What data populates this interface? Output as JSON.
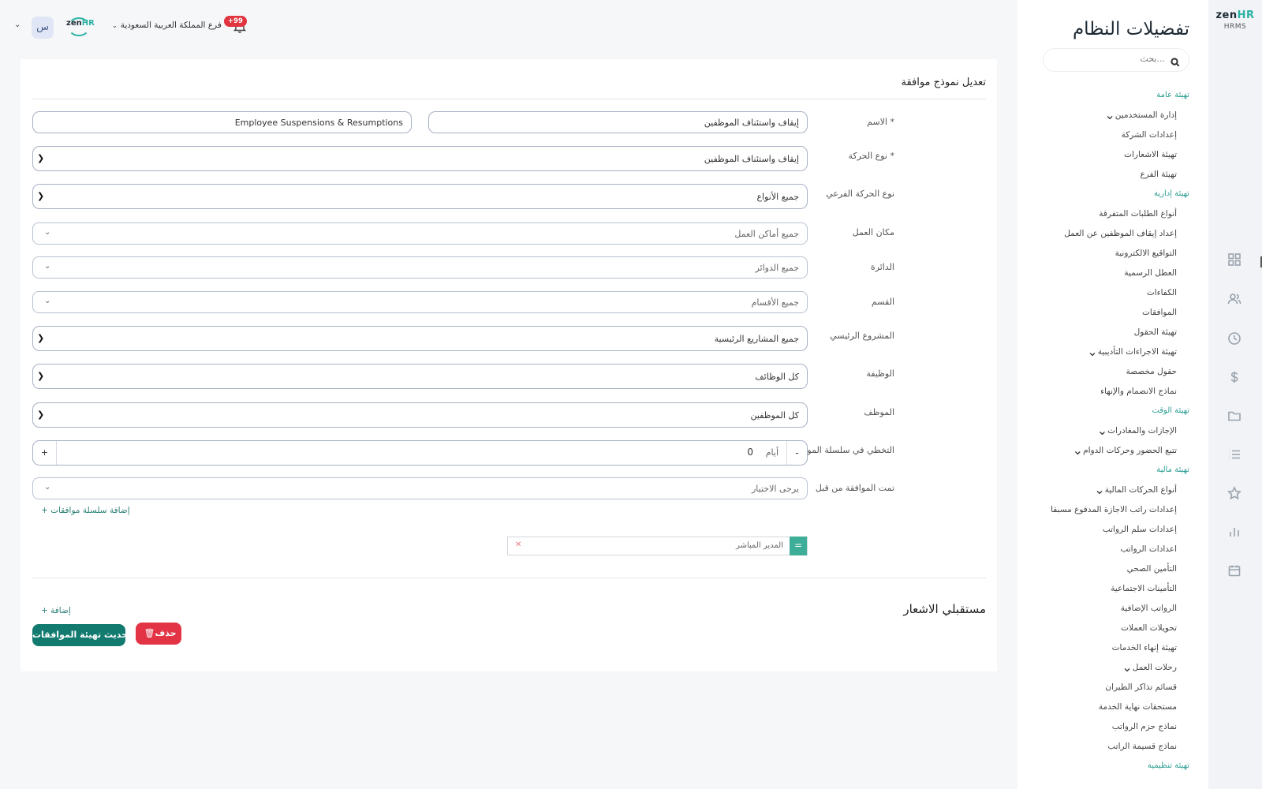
{
  "brand": {
    "logo_main": "zen",
    "logo_accent": "HR",
    "logo_sub": "HRMS"
  },
  "rail": {
    "icons": [
      "grid-icon",
      "users-icon",
      "clock-icon",
      "dollar-icon",
      "folder-icon",
      "list-icon",
      "star-icon",
      "bar-chart-icon",
      "calendar-icon"
    ]
  },
  "topbar": {
    "avatar_letter": "س",
    "branch_label": "فرع المملكة العربية السعودية",
    "notifications_badge": "+99"
  },
  "settings_panel": {
    "title": "تفضيلات النظام",
    "search_placeholder": "بحث...",
    "items": [
      {
        "type": "section",
        "label": "تهيئة عامة"
      },
      {
        "type": "item",
        "label": "إدارة المستخدمين",
        "has_chevron": true
      },
      {
        "type": "item",
        "label": "إعدادات الشركة"
      },
      {
        "type": "item",
        "label": "تهيئة الاشعارات"
      },
      {
        "type": "item",
        "label": "تهيئة الفرع"
      },
      {
        "type": "section",
        "label": "تهيئة إدارية"
      },
      {
        "type": "item",
        "label": "أنواع الطلبات المتفرقة"
      },
      {
        "type": "item",
        "label": "إعداد إيقاف الموظفين عن العمل"
      },
      {
        "type": "item",
        "label": "التواقيع الالكترونية"
      },
      {
        "type": "item",
        "label": "العطل الرسمية"
      },
      {
        "type": "item",
        "label": "الكفاءات"
      },
      {
        "type": "item",
        "label": "الموافقات"
      },
      {
        "type": "item",
        "label": "تهيئة الحقول"
      },
      {
        "type": "item",
        "label": "تهيئة الاجراءات التأديبية",
        "has_chevron": true
      },
      {
        "type": "item",
        "label": "حقول مخصصة"
      },
      {
        "type": "item",
        "label": "نماذج الانضمام والإنهاء"
      },
      {
        "type": "section",
        "label": "تهيئة الوقت"
      },
      {
        "type": "item",
        "label": "الإجازات والمغادرات",
        "has_chevron": true
      },
      {
        "type": "item",
        "label": "تتبع الحضور وحركات الدوام",
        "has_chevron": true
      },
      {
        "type": "section",
        "label": "تهيئة مالية"
      },
      {
        "type": "item",
        "label": "أنواع الحركات المالية",
        "has_chevron": true
      },
      {
        "type": "item",
        "label": "إعدادات راتب الاجازة المدفوع مسبقا"
      },
      {
        "type": "item",
        "label": "إعدادات سلم الرواتب"
      },
      {
        "type": "item",
        "label": "اعدادات الرواتب"
      },
      {
        "type": "item",
        "label": "التأمين الصحي"
      },
      {
        "type": "item",
        "label": "التأمينات الاجتماعية"
      },
      {
        "type": "item",
        "label": "الرواتب الإضافية"
      },
      {
        "type": "item",
        "label": "تحويلات العملات"
      },
      {
        "type": "item",
        "label": "تهيئة إنهاء الخدمات"
      },
      {
        "type": "item",
        "label": "رحلات العمل",
        "has_chevron": true
      },
      {
        "type": "item",
        "label": "قسائم تذاكر الطيران"
      },
      {
        "type": "item",
        "label": "مستحقات نهاية الخدمة"
      },
      {
        "type": "item",
        "label": "نماذج حزم الرواتب"
      },
      {
        "type": "item",
        "label": "نماذج قسيمة الراتب"
      },
      {
        "type": "section",
        "label": "تهيئة تنظيمية"
      }
    ]
  },
  "form": {
    "title": "تعديل نموذج موافقة",
    "name_label": "الاسم *",
    "name_ar": "إيقاف واستئناف الموظفين",
    "name_en": "Employee Suspensions & Resumptions",
    "movement_type_label": "نوع الحركة *",
    "movement_type_value": "إيقاف واستئناف الموظفين",
    "sub_movement_label": "نوع الحركة الفرعي",
    "sub_movement_value": "جميع الأنواع",
    "workplace_label": "مكان العمل",
    "workplace_value": "جميع أماكن العمل",
    "department_label": "الدائرة",
    "department_value": "جميع الدوائر",
    "section_label": "القسم",
    "section_value": "جميع الأقسام",
    "project_label": "المشروع الرئيسي",
    "project_value": "جميع المشاريع الرئيسية",
    "job_label": "الوظيفة",
    "job_value": "كل الوظائف",
    "employee_label": "الموظف",
    "employee_value": "كل الموظفين",
    "skip_label": "التخطي في سلسلة الموافقات بعد",
    "skip_value": "0",
    "skip_unit": "أيام",
    "approved_by_label": "تمت الموافقة من قبل",
    "approved_by_placeholder": "يرجى الاختيار",
    "add_chain_label": "+ إضافة سلسلة موافقات",
    "approver_name": "المدير المباشر",
    "notif_title": "مستقبلي الاشعار",
    "notif_add_label": "+ إضافة",
    "update_button": "تحديث تهيئة الموافقات",
    "delete_button": "حذف"
  }
}
